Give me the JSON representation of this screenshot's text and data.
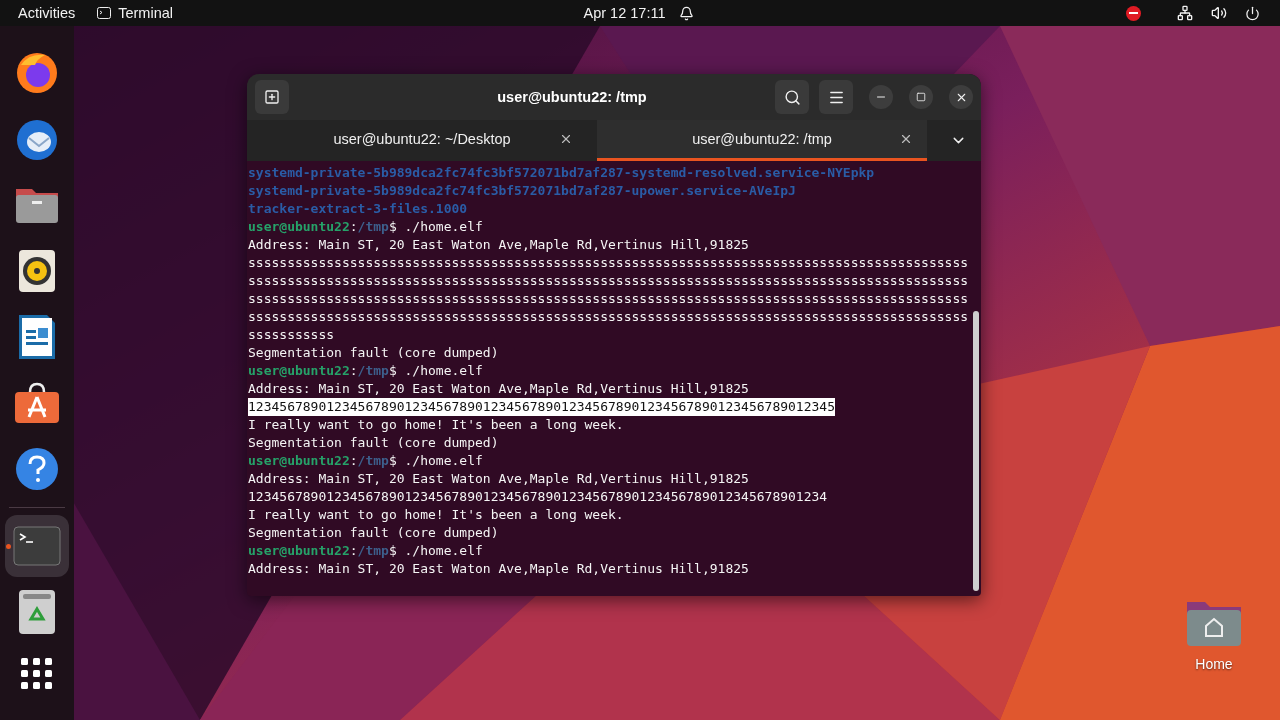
{
  "top_bar": {
    "activities": "Activities",
    "app": "Terminal",
    "clock": "Apr 12  17:11",
    "do_not_disturb": true
  },
  "dock": {
    "apps": [
      {
        "kind": "browser",
        "running": false
      },
      {
        "kind": "mail",
        "running": false
      },
      {
        "kind": "files",
        "running": false
      },
      {
        "kind": "music",
        "running": false
      },
      {
        "kind": "writer",
        "running": false
      },
      {
        "kind": "store",
        "running": false
      },
      {
        "kind": "help",
        "running": false
      },
      {
        "kind": "terminal",
        "running": true
      },
      {
        "kind": "trash",
        "running": false
      }
    ]
  },
  "window": {
    "title": "user@ubuntu22: /tmp",
    "tabs": [
      {
        "label": "user@ubuntu22: ~/Desktop",
        "selected": false
      },
      {
        "label": "user@ubuntu22: /tmp",
        "selected": true
      }
    ],
    "lines": [
      {
        "kind": "listing",
        "text": "systemd-private-5b989dca2fc74fc3bf572071bd7af287-systemd-resolved.service-NYEpkp"
      },
      {
        "kind": "listing",
        "text": "systemd-private-5b989dca2fc74fc3bf572071bd7af287-upower.service-AVeIpJ"
      },
      {
        "kind": "listing",
        "text": "tracker-extract-3-files.1000"
      },
      {
        "kind": "prompt",
        "user": "user@ubuntu22",
        "sep": ":",
        "path": "/tmp",
        "end": "$",
        "command": " ./home.elf"
      },
      {
        "kind": "output",
        "text": "Address: Main ST, 20 East Waton Ave,Maple Rd,Vertinus Hill,91825"
      },
      {
        "kind": "output",
        "text": "ssssssssssssssssssssssssssssssssssssssssssssssssssssssssssssssssssssssssssssssssssssssssssss"
      },
      {
        "kind": "output",
        "text": "ssssssssssssssssssssssssssssssssssssssssssssssssssssssssssssssssssssssssssssssssssssssssssss"
      },
      {
        "kind": "output",
        "text": "ssssssssssssssssssssssssssssssssssssssssssssssssssssssssssssssssssssssssssssssssssssssssssss"
      },
      {
        "kind": "output",
        "text": "ssssssssssssssssssssssssssssssssssssssssssssssssssssssssssssssssssssssssssssssssssssssssssss"
      },
      {
        "kind": "output",
        "text": "sssssssssss"
      },
      {
        "kind": "output",
        "text": "Segmentation fault (core dumped)"
      },
      {
        "kind": "prompt",
        "user": "user@ubuntu22",
        "sep": ":",
        "path": "/tmp",
        "end": "$",
        "command": " ./home.elf"
      },
      {
        "kind": "output",
        "text": "Address: Main ST, 20 East Waton Ave,Maple Rd,Vertinus Hill,91825"
      },
      {
        "kind": "highlighted",
        "text": "123456789012345678901234567890123456789012345678901234567890123456789012345"
      },
      {
        "kind": "output",
        "text": "I really want to go home! It's been a long week."
      },
      {
        "kind": "output",
        "text": "Segmentation fault (core dumped)"
      },
      {
        "kind": "prompt",
        "user": "user@ubuntu22",
        "sep": ":",
        "path": "/tmp",
        "end": "$",
        "command": " ./home.elf"
      },
      {
        "kind": "output",
        "text": "Address: Main ST, 20 East Waton Ave,Maple Rd,Vertinus Hill,91825"
      },
      {
        "kind": "output",
        "text": "12345678901234567890123456789012345678901234567890123456789012345678901234"
      },
      {
        "kind": "output",
        "text": "I really want to go home! It's been a long week."
      },
      {
        "kind": "output",
        "text": "Segmentation fault (core dumped)"
      },
      {
        "kind": "prompt",
        "user": "user@ubuntu22",
        "sep": ":",
        "path": "/tmp",
        "end": "$",
        "command": " ./home.elf"
      },
      {
        "kind": "output",
        "text": "Address: Main ST, 20 East Waton Ave,Maple Rd,Vertinus Hill,91825"
      }
    ]
  },
  "desktop_icons": [
    {
      "label": "Home"
    }
  ]
}
